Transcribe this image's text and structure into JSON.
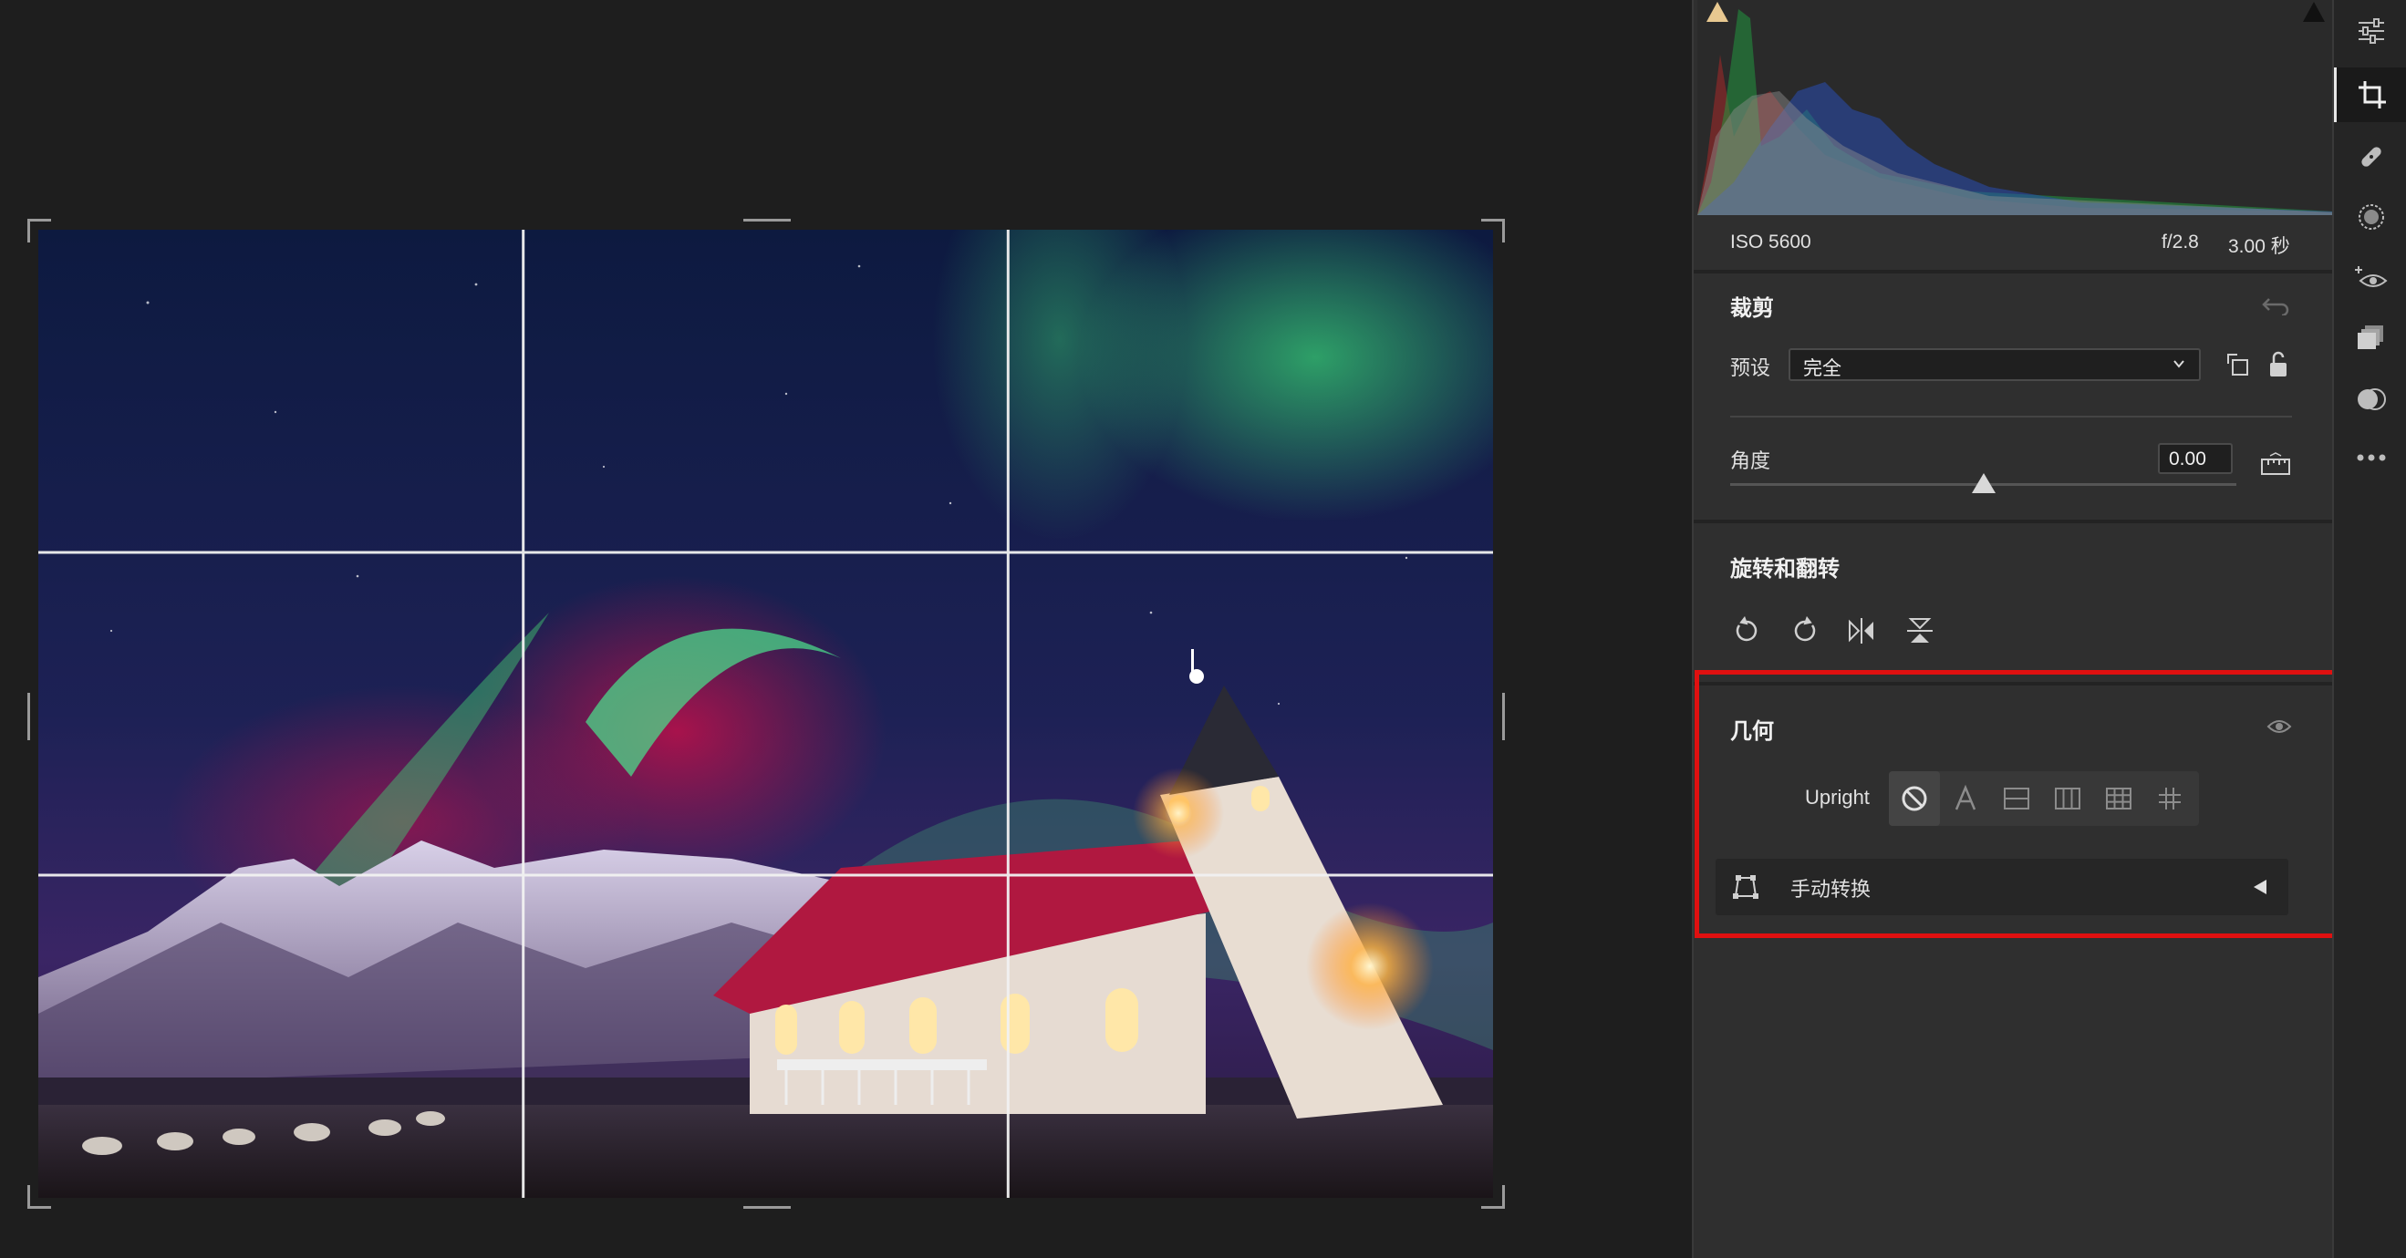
{
  "exif": {
    "iso": "ISO 5600",
    "aperture": "f/2.8",
    "shutter": "3.00 秒"
  },
  "crop": {
    "title": "裁剪",
    "preset_label": "预设",
    "preset_value": "完全",
    "angle_label": "角度",
    "angle_value": "0.00",
    "angle_level": 0.5
  },
  "rotate": {
    "title": "旋转和翻转"
  },
  "geometry": {
    "title": "几何",
    "upright_label": "Upright",
    "upright_modes": [
      "off",
      "auto",
      "level",
      "vertical",
      "full",
      "guided"
    ],
    "upright_active": "off",
    "manual_label": "手动转换"
  },
  "tools": [
    "edit-sliders-icon",
    "crop-icon",
    "healing-icon",
    "masking-icon",
    "red-eye-icon",
    "presets-icon",
    "snapshot-icon",
    "more-icon"
  ],
  "active_tool": "crop-icon",
  "colors": {
    "panel_bg": "#2f2f2f",
    "canvas_bg": "#1e1e1e",
    "highlight": "#e01010"
  }
}
